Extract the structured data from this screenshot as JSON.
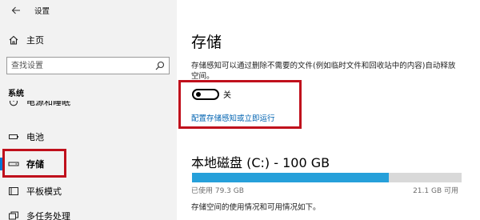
{
  "window": {
    "title": "设置"
  },
  "sidebar": {
    "home_label": "主页",
    "search": {
      "placeholder": "查找设置"
    },
    "section_label": "系统",
    "cut_item_label": "电源和睡眠",
    "items": [
      {
        "label": "电池",
        "icon": "battery-icon"
      },
      {
        "label": "存储",
        "icon": "storage-icon",
        "selected": true
      },
      {
        "label": "平板模式",
        "icon": "tablet-mode-icon"
      },
      {
        "label": "多任务处理",
        "icon": "multitasking-icon"
      }
    ]
  },
  "main": {
    "title": "存储",
    "description": "存储感知可以通过删除不需要的文件(例如临时文件和回收站中的内容)自动释放空间。",
    "toggle": {
      "state_label": "关",
      "on": false
    },
    "configure_link": "配置存储感知或立即运行",
    "disk": {
      "title": "本地磁盘 (C:) - 100 GB",
      "used_label": "已使用 79.3 GB",
      "free_label": "21.1 GB 可用",
      "used_fraction": 0.73
    },
    "usage_description": "存储空间的使用情况和可用情况如下。"
  },
  "colors": {
    "accent": "#0078d7",
    "link": "#0063b1",
    "usage_fill": "#26a0da",
    "highlight": "#c0101c"
  }
}
